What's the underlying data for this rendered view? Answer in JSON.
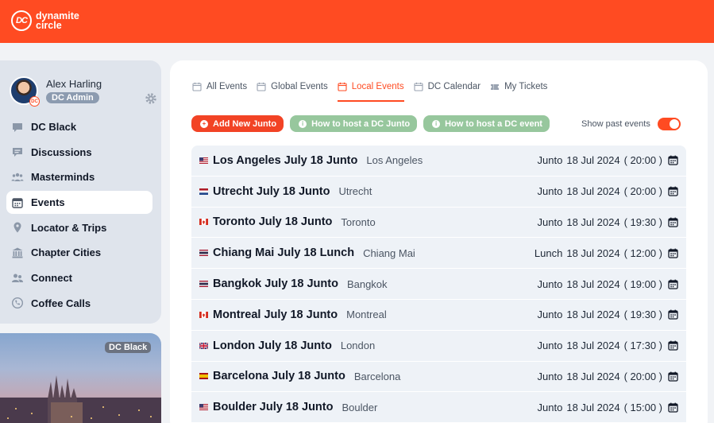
{
  "brand": {
    "mark": "DC",
    "line1": "dynamite",
    "line2": "circle"
  },
  "user": {
    "name": "Alex Harling",
    "role": "DC Admin",
    "avatar_badge": "DC"
  },
  "nav": [
    {
      "label": "DC Black",
      "icon": "chat-bubble-icon"
    },
    {
      "label": "Discussions",
      "icon": "discussion-icon"
    },
    {
      "label": "Masterminds",
      "icon": "group-icon"
    },
    {
      "label": "Events",
      "icon": "calendar-icon",
      "active": true
    },
    {
      "label": "Locator & Trips",
      "icon": "map-pin-icon"
    },
    {
      "label": "Chapter Cities",
      "icon": "building-icon"
    },
    {
      "label": "Connect",
      "icon": "people-icon"
    },
    {
      "label": "Coffee Calls",
      "icon": "phone-icon"
    }
  ],
  "promo": {
    "badge": "DC Black"
  },
  "tabs": [
    {
      "label": "All Events"
    },
    {
      "label": "Global Events"
    },
    {
      "label": "Local Events",
      "active": true
    },
    {
      "label": "DC Calendar"
    },
    {
      "label": "My Tickets"
    }
  ],
  "actions": {
    "add": "Add New Junto",
    "howto_junto": "How to host a DC Junto",
    "howto_event": "How to host a DC event",
    "show_past": "Show past events",
    "show_past_on": true
  },
  "events": [
    {
      "title": "Los Angeles July 18 Junto",
      "city": "Los Angeles",
      "type": "Junto",
      "date": "18 Jul 2024",
      "time": "( 20:00 )",
      "flag": "us"
    },
    {
      "title": "Utrecht July 18 Junto",
      "city": "Utrecht",
      "type": "Junto",
      "date": "18 Jul 2024",
      "time": "( 20:00 )",
      "flag": "nl"
    },
    {
      "title": "Toronto July 18 Junto",
      "city": "Toronto",
      "type": "Junto",
      "date": "18 Jul 2024",
      "time": "( 19:30 )",
      "flag": "ca"
    },
    {
      "title": "Chiang Mai July 18 Lunch",
      "city": "Chiang Mai",
      "type": "Lunch",
      "date": "18 Jul 2024",
      "time": "( 12:00 )",
      "flag": "th"
    },
    {
      "title": "Bangkok July 18 Junto",
      "city": "Bangkok",
      "type": "Junto",
      "date": "18 Jul 2024",
      "time": "( 19:00 )",
      "flag": "th"
    },
    {
      "title": "Montreal July 18 Junto",
      "city": "Montreal",
      "type": "Junto",
      "date": "18 Jul 2024",
      "time": "( 19:30 )",
      "flag": "ca"
    },
    {
      "title": "London July 18 Junto",
      "city": "London",
      "type": "Junto",
      "date": "18 Jul 2024",
      "time": "( 17:30 )",
      "flag": "gb"
    },
    {
      "title": "Barcelona July 18 Junto",
      "city": "Barcelona",
      "type": "Junto",
      "date": "18 Jul 2024",
      "time": "( 20:00 )",
      "flag": "es"
    },
    {
      "title": "Boulder July 18 Junto",
      "city": "Boulder",
      "type": "Junto",
      "date": "18 Jul 2024",
      "time": "( 15:00 )",
      "flag": "us"
    }
  ],
  "colors": {
    "brand": "#ff4b22",
    "primary_button": "#f24325",
    "secondary_button": "#97c79d",
    "row": "#eef2f7"
  }
}
